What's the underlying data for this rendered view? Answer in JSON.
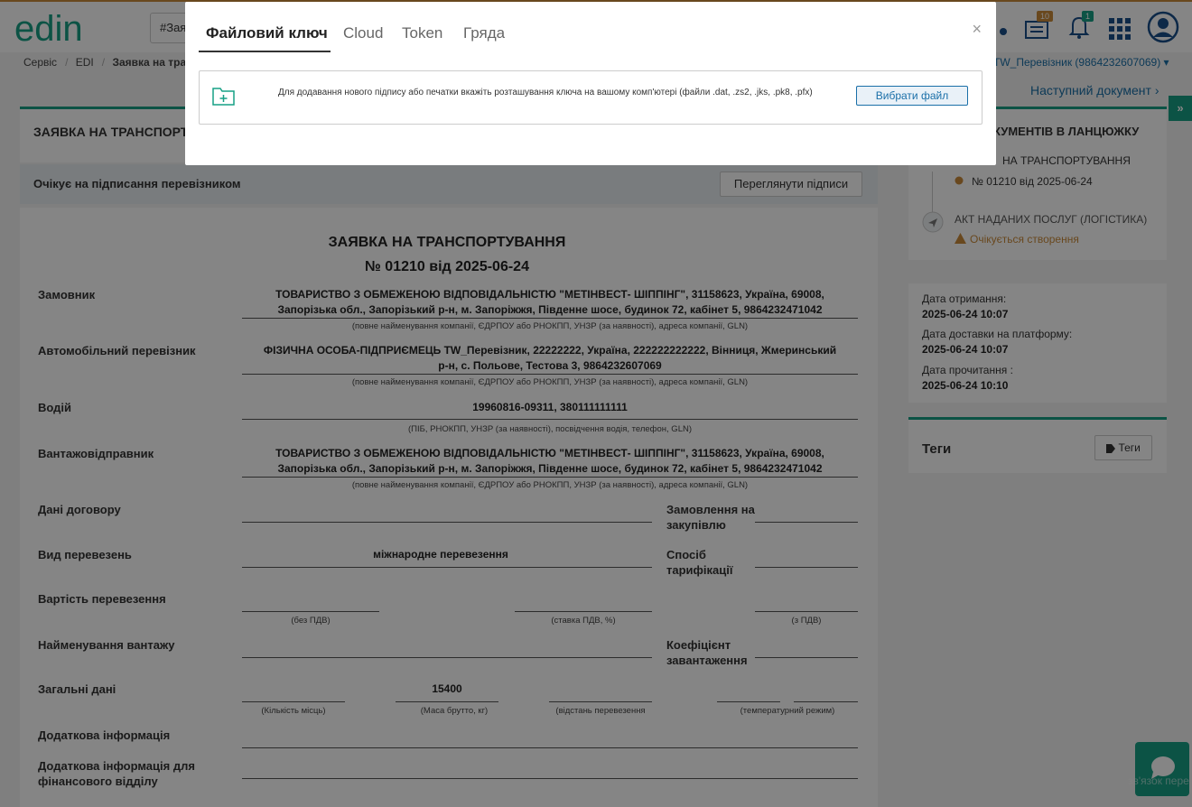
{
  "header": {
    "search_value": "#Зая",
    "logo_text": "edin",
    "archive_badge": "10",
    "notifications_badge": "1",
    "user_line": "TW_Перевізник (9864232607069)"
  },
  "breadcrumb": [
    "Сервіс",
    "EDI",
    "Заявка на тра"
  ],
  "next_document": "Наступний документ",
  "document_title": "ЗАЯВКА НА ТРАНСПОРТУ",
  "status": {
    "text": "Очікує на підписання перевізником",
    "view_signatures": "Переглянути підписи"
  },
  "document": {
    "heading": "ЗАЯВКА НА ТРАНСПОРТУВАННЯ",
    "number": "№ 01210 від 2025-06-24",
    "customer_label": "Замовник",
    "customer_value_1": "ТОВАРИСТВО З ОБМЕЖЕНОЮ ВІДПОВІДАЛЬНІСТЮ \"МЕТІНВЕСТ- ШІППІНГ\", 31158623, Україна, 69008,",
    "customer_value_2": "Запорізька обл., Запорізький р-н, м. Запоріжжя, Південне шосе, будинок 72, кабінет 5, 9864232471042",
    "company_hint": "(повне найменування компанії, ЄДРПОУ або РНОКПП, УНЗР (за наявності), адреса компанії, GLN)",
    "carrier_label": "Автомобільний перевізник",
    "carrier_value_1": "ФІЗИЧНА ОСОБА-ПІДПРИЄМЕЦЬ TW_Перевізник, 22222222, Україна, 222222222222, Вінниця, Жмеринський",
    "carrier_value_2": "р-н, с. Польове, Тестова 3, 9864232607069",
    "driver_label": "Водій",
    "driver_value": "19960816-09311, 380111111111",
    "driver_hint": "(ПІБ, РНОКПП, УНЗР (за наявності), посвідчення водія, телефон, GLN)",
    "shipper_label": "Вантажовідправник",
    "contract_label": "Дані договору",
    "purchase_order_label_1": "Замовлення на",
    "purchase_order_label_2": "закупівлю",
    "transport_type_label": "Вид перевезень",
    "transport_type_value": "міжнародне перевезення",
    "tariff_label_1": "Спосіб",
    "tariff_label_2": "тарифікації",
    "cost_label": "Вартість перевезення",
    "hint_no_vat": "(без ПДВ)",
    "hint_vat_rate": "(ставка ПДВ, %)",
    "hint_with_vat": "(з ПДВ)",
    "cargo_name_label": "Найменування вантажу",
    "load_coef_label_1": "Коефіцієнт",
    "load_coef_label_2": "завантаження",
    "general_label": "Загальні дані",
    "gross_mass_value": "15400",
    "hint_places": "(Кількість місць)",
    "hint_mass": "(Маса брутто, кг)",
    "hint_distance": "(відстань перевезення",
    "hint_temp": "(температурний режим)",
    "additional_info_label": "Додаткова інформація",
    "fin_info_label_1": "Додаткова інформація для",
    "fin_info_label_2": "фінансового відділу"
  },
  "chain": {
    "title": "КУМЕНТІВ В ЛАНЦЮЖКУ",
    "item1_title": "НА ТРАНСПОРТУВАННЯ",
    "item1_sub": "№ 01210 від 2025-06-24",
    "item2_title": "АКТ НАДАНИХ ПОСЛУГ (ЛОГІСТИКА)",
    "item2_sub": "Очікується створення"
  },
  "meta": {
    "received_label": "Дата отримання:",
    "received_value": "2025-06-24 10:07",
    "delivered_label": "Дата доставки на платформу:",
    "delivered_value": "2025-06-24 10:07",
    "read_label": "Дата прочитання :",
    "read_value": "2025-06-24 10:10"
  },
  "tags": {
    "title": "Теги",
    "button": "Теги"
  },
  "modal": {
    "tabs": [
      "Файловий ключ",
      "Cloud",
      "Token",
      "Гряда"
    ],
    "close": "×",
    "key_text": "Для додавання нового підпису або печатки вкажіть розташування ключа на вашому комп'ютері (файли .dat, .zs2, .jks, .pk8, .pfx)",
    "choose_file": "Вибрати файл"
  },
  "chat_text": "зв'язок пере"
}
